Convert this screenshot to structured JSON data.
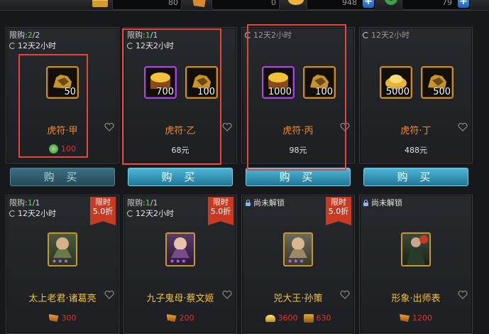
{
  "resources": [
    {
      "icon": "gold-chest-icon",
      "value": "80"
    },
    {
      "icon": "scroll-ticket-icon",
      "value": "0"
    },
    {
      "icon": "gold-ingot-icon",
      "value": "948"
    },
    {
      "icon": "jade-coin-icon",
      "value": "79"
    }
  ],
  "buy_label": "购 买",
  "cards_row1": [
    {
      "limit_prefix": "限购:",
      "limit_cur": "2",
      "limit_total": "/2",
      "timer": "12天2小时",
      "items": [
        {
          "icon": "tiger-tally-icon",
          "count": "50",
          "frame": "gold"
        }
      ],
      "name": "虎符·甲",
      "price_icon": "jade-coin-icon",
      "price": "100",
      "price_red": true
    },
    {
      "limit_prefix": "限购:",
      "limit_cur": "1",
      "limit_total": "/1",
      "timer": "12天2小时",
      "items": [
        {
          "icon": "gold-treasure-chest-icon",
          "count": "700",
          "frame": "purple"
        },
        {
          "icon": "tiger-tally-icon",
          "count": "100",
          "frame": "gold"
        }
      ],
      "name": "虎符·乙",
      "price": "68元",
      "price_red": false
    },
    {
      "timer": "12天2小时",
      "items": [
        {
          "icon": "gold-treasure-chest-icon",
          "count": "1000",
          "frame": "purple"
        },
        {
          "icon": "tiger-tally-icon",
          "count": "100",
          "frame": "gold"
        }
      ],
      "name": "虎符·丙",
      "price": "98元",
      "price_red": false
    },
    {
      "timer": "12天2小时",
      "items": [
        {
          "icon": "gold-pile-icon",
          "count": "5000",
          "frame": "gold"
        },
        {
          "icon": "tiger-tally-icon",
          "count": "500",
          "frame": "gold"
        }
      ],
      "name": "虎符·丁",
      "price": "488元",
      "price_red": false
    }
  ],
  "cards_row2": [
    {
      "header_type": "limit",
      "limit_prefix": "限购:",
      "limit_cur": "1",
      "limit_total": "/1",
      "timer": "12天2小时",
      "badge": [
        "限时",
        "5.0折"
      ],
      "name": "太上老君·诸葛亮",
      "price_items": [
        {
          "icon": "scroll-ticket-icon",
          "value": "300"
        }
      ]
    },
    {
      "header_type": "limit",
      "limit_prefix": "限购:",
      "limit_cur": "1",
      "limit_total": "/1",
      "timer": "12天2小时",
      "badge": [
        "限时",
        "5.0折"
      ],
      "name": "九子鬼母·蔡文姬",
      "price_items": [
        {
          "icon": "scroll-ticket-icon",
          "value": "200"
        }
      ]
    },
    {
      "header_type": "locked",
      "locked_text": "尚未解锁",
      "badge": [
        "限时",
        "5.0折"
      ],
      "name": "兕大王·孙策",
      "price_items": [
        {
          "icon": "gold-ingot-icon",
          "value": "3600"
        },
        {
          "icon": "tiger-tally-icon",
          "value": "630"
        }
      ]
    },
    {
      "header_type": "locked",
      "locked_text": "尚未解锁",
      "name": "形象·出师表",
      "price_items": [
        {
          "icon": "scroll-ticket-icon",
          "value": "1200"
        }
      ]
    }
  ]
}
